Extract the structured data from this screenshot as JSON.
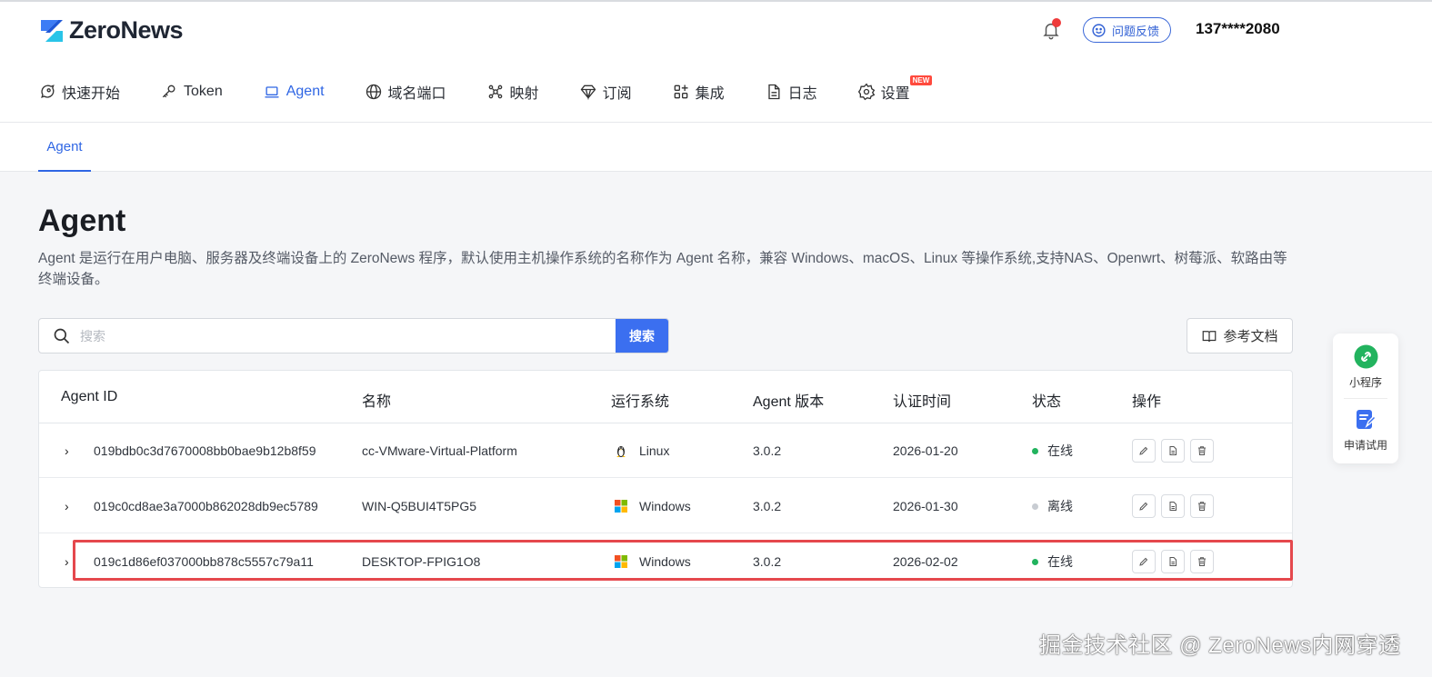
{
  "header": {
    "logo_text": "ZeroNews",
    "feedback_label": "问题反馈",
    "user": "137****2080",
    "brand_color": "#2f66e4"
  },
  "nav": [
    {
      "label": "快速开始",
      "icon": "rocket-icon"
    },
    {
      "label": "Token",
      "icon": "key-icon"
    },
    {
      "label": "Agent",
      "icon": "laptop-icon",
      "active": true
    },
    {
      "label": "域名端口",
      "icon": "globe-icon"
    },
    {
      "label": "映射",
      "icon": "mapping-icon"
    },
    {
      "label": "订阅",
      "icon": "diamond-icon"
    },
    {
      "label": "集成",
      "icon": "integration-icon"
    },
    {
      "label": "日志",
      "icon": "document-icon"
    },
    {
      "label": "设置",
      "icon": "gear-icon",
      "badge": "NEW"
    }
  ],
  "subtab": "Agent",
  "page": {
    "title": "Agent",
    "description": "Agent 是运行在用户电脑、服务器及终端设备上的 ZeroNews 程序，默认使用主机操作系统的名称作为 Agent 名称，兼容 Windows、macOS、Linux 等操作系统,支持NAS、Openwrt、树莓派、软路由等终端设备。"
  },
  "search": {
    "placeholder": "搜索",
    "button": "搜索"
  },
  "docs_button": "参考文档",
  "table": {
    "columns": [
      "Agent ID",
      "名称",
      "运行系统",
      "Agent 版本",
      "认证时间",
      "状态",
      "操作"
    ],
    "rows": [
      {
        "id": "019bdb0c3d7670008bb0bae9b12b8f59",
        "name": "cc-VMware-Virtual-Platform",
        "os": "Linux",
        "os_icon": "linux-icon",
        "version": "3.0.2",
        "auth_time": "2026-01-20",
        "status": "在线",
        "status_color": "#22b35e"
      },
      {
        "id": "019c0cd8ae3a7000b862028db9ec5789",
        "name": "WIN-Q5BUI4T5PG5",
        "os": "Windows",
        "os_icon": "windows-icon",
        "version": "3.0.2",
        "auth_time": "2026-01-30",
        "status": "离线",
        "status_color": "#c8ccd2"
      },
      {
        "id": "019c1d86ef037000bb878c5557c79a11",
        "name": "DESKTOP-FPIG1O8",
        "os": "Windows",
        "os_icon": "windows-icon",
        "version": "3.0.2",
        "auth_time": "2026-02-02",
        "status": "在线",
        "status_color": "#22b35e"
      }
    ]
  },
  "side_panel": {
    "miniprogram_label": "小程序",
    "trial_label": "申请试用"
  },
  "watermark": "掘金技术社区 @ ZeroNews内网穿透"
}
